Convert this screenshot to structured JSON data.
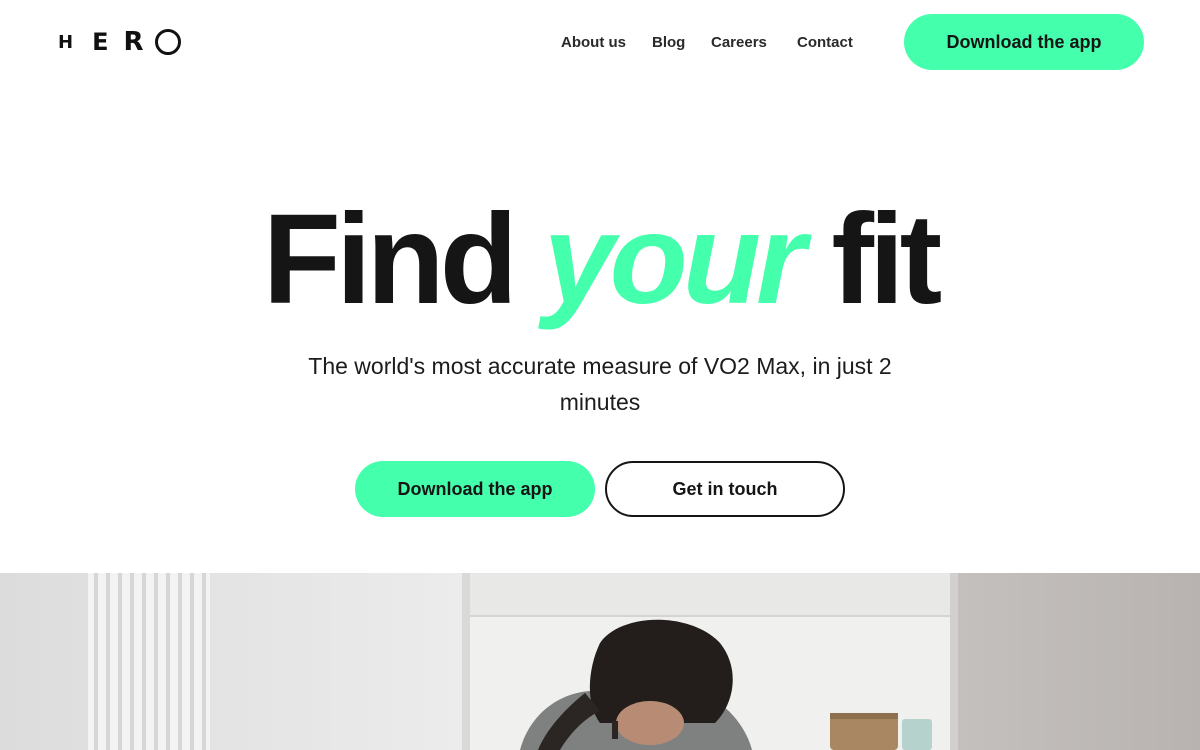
{
  "brand": {
    "logo_text": "HERO"
  },
  "nav": {
    "items": [
      {
        "label": "About us"
      },
      {
        "label": "Blog"
      },
      {
        "label": "Careers"
      },
      {
        "label": "Contact"
      }
    ],
    "cta_label": "Download the app"
  },
  "hero": {
    "title_part1": "Find",
    "title_accent": "your",
    "title_part2": "fit",
    "subtitle": "The world's most accurate measure of VO2 Max, in just 2 minutes",
    "primary_button": "Download the app",
    "secondary_button": "Get in touch"
  },
  "colors": {
    "accent": "#44ffac",
    "text": "#151515",
    "background": "#ffffff"
  },
  "image": {
    "subject": "person-exercising-indoors"
  }
}
